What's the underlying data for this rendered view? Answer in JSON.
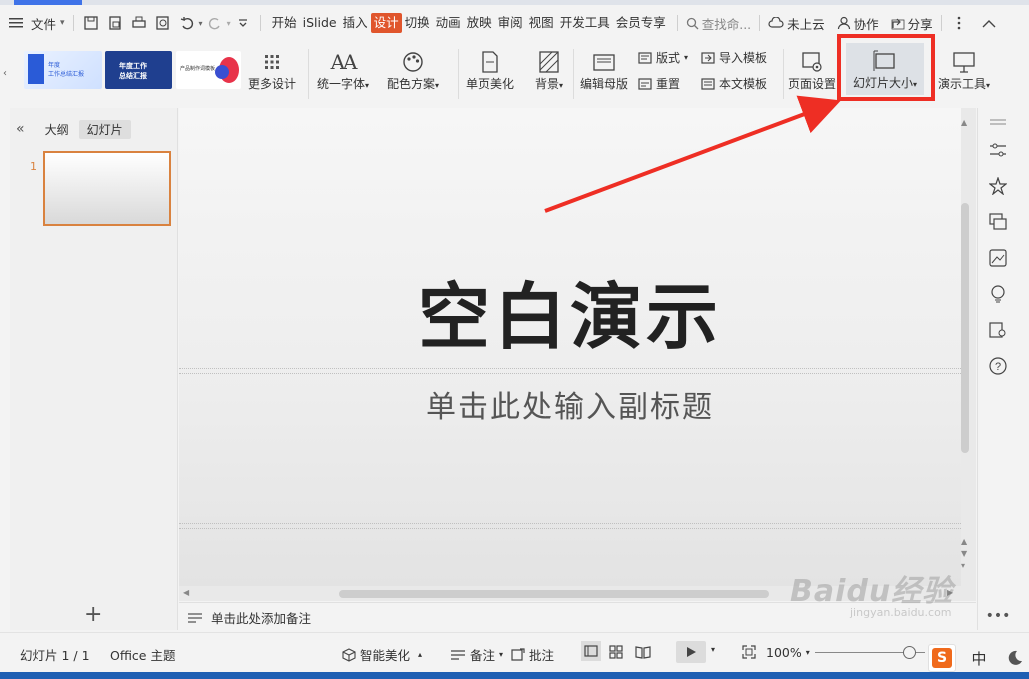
{
  "menubar": {
    "file_label": "文件",
    "tabs": [
      "开始",
      "iSlide",
      "插入",
      "设计",
      "切换",
      "动画",
      "放映",
      "审阅",
      "视图",
      "开发工具",
      "会员专享"
    ],
    "active_tab": "设计",
    "search_label": "查找命...",
    "cloud_label": "未上云",
    "collab_label": "协作",
    "share_label": "分享"
  },
  "ribbon": {
    "more_design": "更多设计",
    "unify_font": "统一字体",
    "color_scheme": "配色方案",
    "page_beautify": "单页美化",
    "background": "背景",
    "edit_master": "编辑母版",
    "layout": "版式",
    "reset": "重置",
    "import_template": "导入模板",
    "text_template": "本文模板",
    "page_setup": "页面设置",
    "slide_size": "幻灯片大小",
    "present_tools": "演示工具",
    "thumbs": [
      {
        "line1": "年度",
        "line2": "工作总结汇报"
      },
      {
        "line1": "年度工作",
        "line2": "总结汇报"
      },
      {
        "line1": "产品制作词模板",
        "line2": ""
      }
    ]
  },
  "leftpanel": {
    "tab_outline": "大纲",
    "tab_slides": "幻灯片",
    "slide_number": "1"
  },
  "slide": {
    "title": "空白演示",
    "subtitle": "单击此处输入副标题"
  },
  "notes": {
    "placeholder": "单击此处添加备注"
  },
  "statusbar": {
    "slide_counter": "幻灯片 1 / 1",
    "theme": "Office 主题",
    "smart_beautify": "智能美化",
    "notes": "备注",
    "comments": "批注",
    "zoom": "100%"
  },
  "ime": {
    "sogou": "S",
    "lang": "中"
  },
  "watermark": {
    "text1": "Baidu经验",
    "text2": "jingyan.baidu.com"
  },
  "colors": {
    "accent_tab": "#e0552c",
    "highlight": "#ee2e24",
    "thumb_accent": "#d9823f"
  }
}
